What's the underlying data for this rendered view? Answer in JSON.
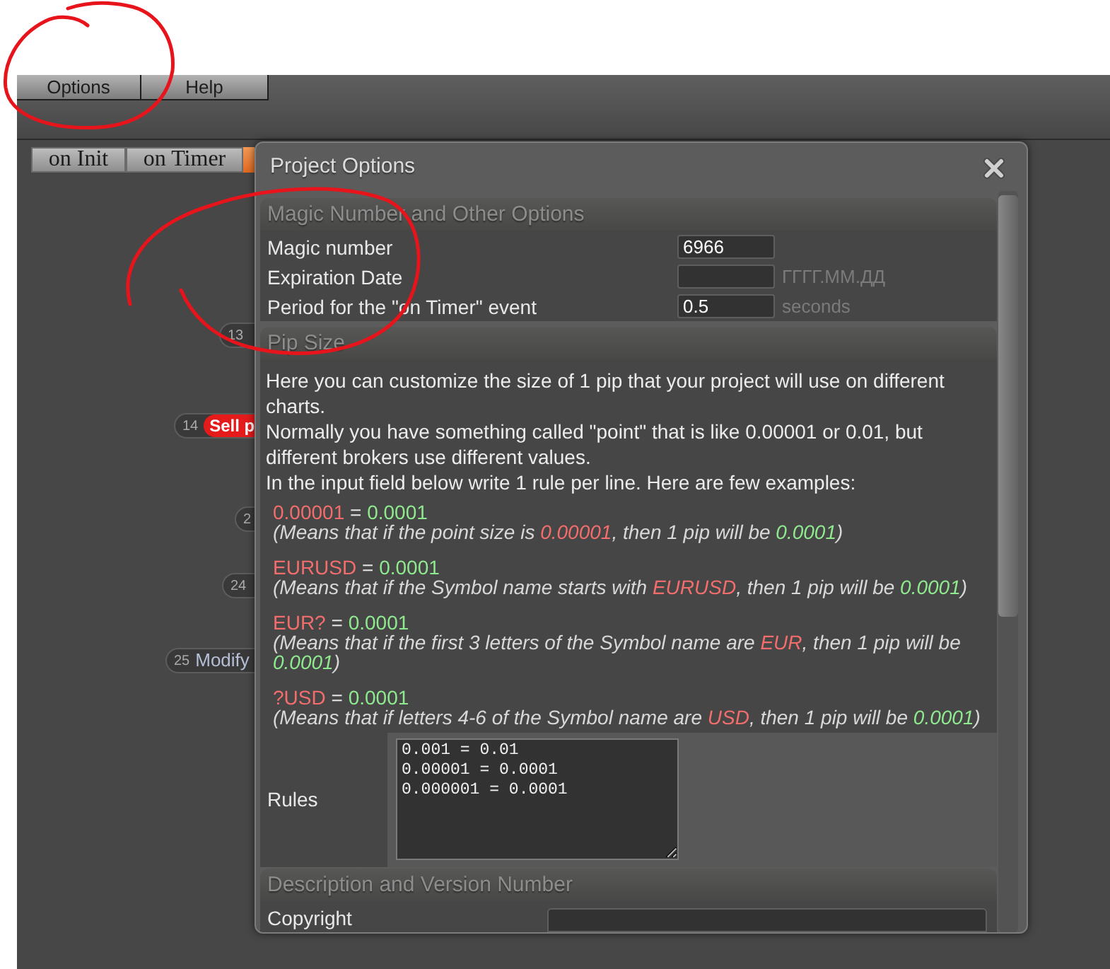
{
  "menu": [
    {
      "label": "Options"
    },
    {
      "label": "Help"
    }
  ],
  "tabs": [
    {
      "label": "on Init"
    },
    {
      "label": "on Timer"
    }
  ],
  "canvas_nodes": [
    {
      "number": "13",
      "kind": "plain"
    },
    {
      "number": "14",
      "kind": "sell",
      "label": "Sell p"
    },
    {
      "number": "2",
      "kind": "plain"
    },
    {
      "number": "24",
      "kind": "plain"
    },
    {
      "number": "25",
      "kind": "modify",
      "label": "Modify"
    }
  ],
  "dialog": {
    "title": "Project Options",
    "sections": [
      {
        "kind": "fields",
        "title": "Magic Number and Other Options",
        "fields": [
          {
            "label": "Magic number",
            "value": "6966"
          },
          {
            "label": "Expiration Date",
            "suffix": "ГГГГ.ММ.ДД"
          },
          {
            "label": "Period for the \"on Timer\" event",
            "value": "0.5",
            "suffix": "seconds"
          }
        ]
      },
      {
        "kind": "pip_size",
        "title": "Pip Size",
        "intro": [
          "Here you can customize the size of 1 pip that your project will use on different charts.",
          "Normally you have something called \"point\" that is like 0.00001 or 0.01, but different brokers use different values.",
          "In the input field below write 1 rule per line. Here are few examples:"
        ],
        "examples": [
          {
            "rule": [
              {
                "kind": "pattern",
                "text": "0.00001"
              },
              {
                "kind": "text",
                "text": " = "
              },
              {
                "kind": "value",
                "text": "0.0001"
              }
            ],
            "explanation": [
              {
                "kind": "text",
                "text": "(Means that if the point size is "
              },
              {
                "kind": "pattern",
                "text": "0.00001"
              },
              {
                "kind": "text",
                "text": ", then 1 pip will be "
              },
              {
                "kind": "value",
                "text": "0.0001"
              },
              {
                "kind": "text",
                "text": ")"
              }
            ]
          },
          {
            "rule": [
              {
                "kind": "pattern",
                "text": "EURUSD"
              },
              {
                "kind": "text",
                "text": " = "
              },
              {
                "kind": "value",
                "text": "0.0001"
              }
            ],
            "explanation": [
              {
                "kind": "text",
                "text": "(Means that if the Symbol name starts with "
              },
              {
                "kind": "pattern",
                "text": "EURUSD"
              },
              {
                "kind": "text",
                "text": ", then 1 pip will be "
              },
              {
                "kind": "value",
                "text": "0.0001"
              },
              {
                "kind": "text",
                "text": ")"
              }
            ]
          },
          {
            "rule": [
              {
                "kind": "pattern",
                "text": "EUR?"
              },
              {
                "kind": "text",
                "text": " = "
              },
              {
                "kind": "value",
                "text": "0.0001"
              }
            ],
            "explanation": [
              {
                "kind": "text",
                "text": "(Means that if the first 3 letters of the Symbol name are "
              },
              {
                "kind": "pattern",
                "text": "EUR"
              },
              {
                "kind": "text",
                "text": ", then 1 pip will be "
              },
              {
                "kind": "value",
                "text": "0.0001"
              },
              {
                "kind": "text",
                "text": ")"
              }
            ]
          },
          {
            "rule": [
              {
                "kind": "pattern",
                "text": "?USD"
              },
              {
                "kind": "text",
                "text": " = "
              },
              {
                "kind": "value",
                "text": "0.0001"
              }
            ],
            "explanation": [
              {
                "kind": "text",
                "text": "(Means that if letters 4-6 of the Symbol name are "
              },
              {
                "kind": "pattern",
                "text": "USD"
              },
              {
                "kind": "text",
                "text": ", then 1 pip will be "
              },
              {
                "kind": "value",
                "text": "0.0001"
              },
              {
                "kind": "text",
                "text": ")"
              }
            ]
          }
        ],
        "rules": {
          "label": "Rules",
          "value": "0.001 = 0.01\n0.00001 = 0.0001\n0.000001 = 0.0001"
        }
      },
      {
        "kind": "wide_fields",
        "title": "Description and Version Number",
        "fields": [
          {
            "label": "Copyright"
          }
        ]
      }
    ]
  }
}
